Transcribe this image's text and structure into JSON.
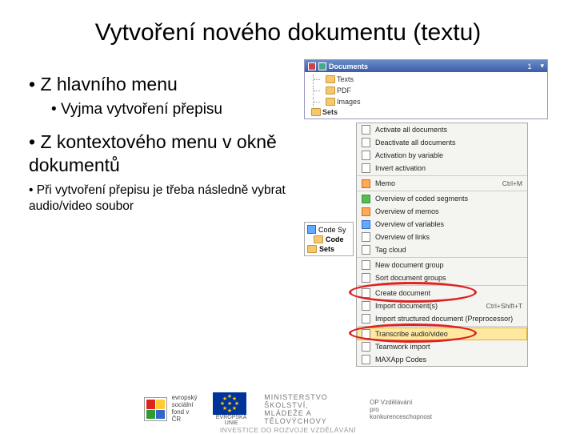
{
  "title": "Vytvoření nového dokumentu (textu)",
  "bullets": {
    "b1": "Z hlavního menu",
    "b1a": "Vyjma vytvoření přepisu",
    "b2": "Z kontextového menu v okně dokumentů",
    "b3": "Při vytvoření přepisu je třeba následně vybrat audio/video soubor"
  },
  "panel1": {
    "header": "Documents",
    "count": "1",
    "tree": [
      "Texts",
      "PDF",
      "Images",
      "Sets"
    ]
  },
  "menu1": {
    "items": [
      {
        "label": "Activate all documents"
      },
      {
        "label": "Deactivate all documents"
      },
      {
        "label": "Activation by variable"
      },
      {
        "label": "Invert activation"
      },
      {
        "sep": true
      },
      {
        "label": "Memo",
        "shortcut": "Ctrl+M",
        "icon": "memo"
      },
      {
        "sep": true
      },
      {
        "label": "Overview of coded segments",
        "icon": "green"
      },
      {
        "label": "Overview of memos",
        "icon": "orange"
      },
      {
        "label": "Overview of variables",
        "icon": "blue"
      },
      {
        "label": "Overview of links"
      },
      {
        "label": "Tag cloud"
      },
      {
        "sep": true
      },
      {
        "label": "New document group"
      },
      {
        "label": "Sort document groups"
      },
      {
        "sep": true
      },
      {
        "label": "Create document",
        "circled": true
      },
      {
        "label": "Import document(s)",
        "shortcut": "Ctrl+Shift+T"
      },
      {
        "label": "Import structured document (Preprocessor)"
      },
      {
        "sep": true
      },
      {
        "label": "Transcribe audio/video",
        "highlight": true
      },
      {
        "label": "Teamwork import"
      },
      {
        "label": "MAXApp Codes"
      }
    ]
  },
  "tree2": {
    "rows": [
      "Code Sy",
      "Code",
      "Sets"
    ]
  },
  "footer": {
    "esf": "evropský\nsociální\nfond v ČR",
    "eu": "EVROPSKÁ UNIE",
    "msmt": "MINISTERSTVO ŠKOLSTVÍ,\nMLÁDEŽE A TĚLOVÝCHOVY",
    "opvk": "OP Vzdělávání\npro konkurenceschopnost",
    "line": "INVESTICE DO ROZVOJE VZDĚLÁVÁNÍ"
  }
}
